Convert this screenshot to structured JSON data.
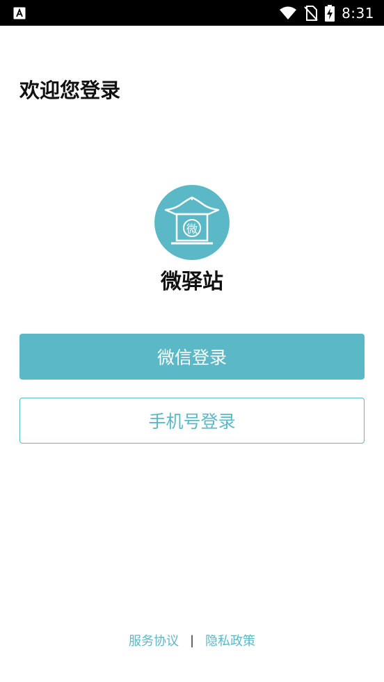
{
  "status_bar": {
    "time": "8:31",
    "icons": [
      "app-notification-icon",
      "wifi-icon",
      "no-sim-icon",
      "battery-charging-icon"
    ]
  },
  "header": {
    "title": "欢迎您登录"
  },
  "app": {
    "name": "微驿站",
    "logo_char": "微"
  },
  "buttons": {
    "wechat_login": "微信登录",
    "phone_login": "手机号登录"
  },
  "footer": {
    "terms": "服务协议",
    "separator": "|",
    "privacy": "隐私政策"
  },
  "colors": {
    "accent": "#5bb8c7",
    "status_bar": "#000000",
    "background": "#ffffff"
  }
}
